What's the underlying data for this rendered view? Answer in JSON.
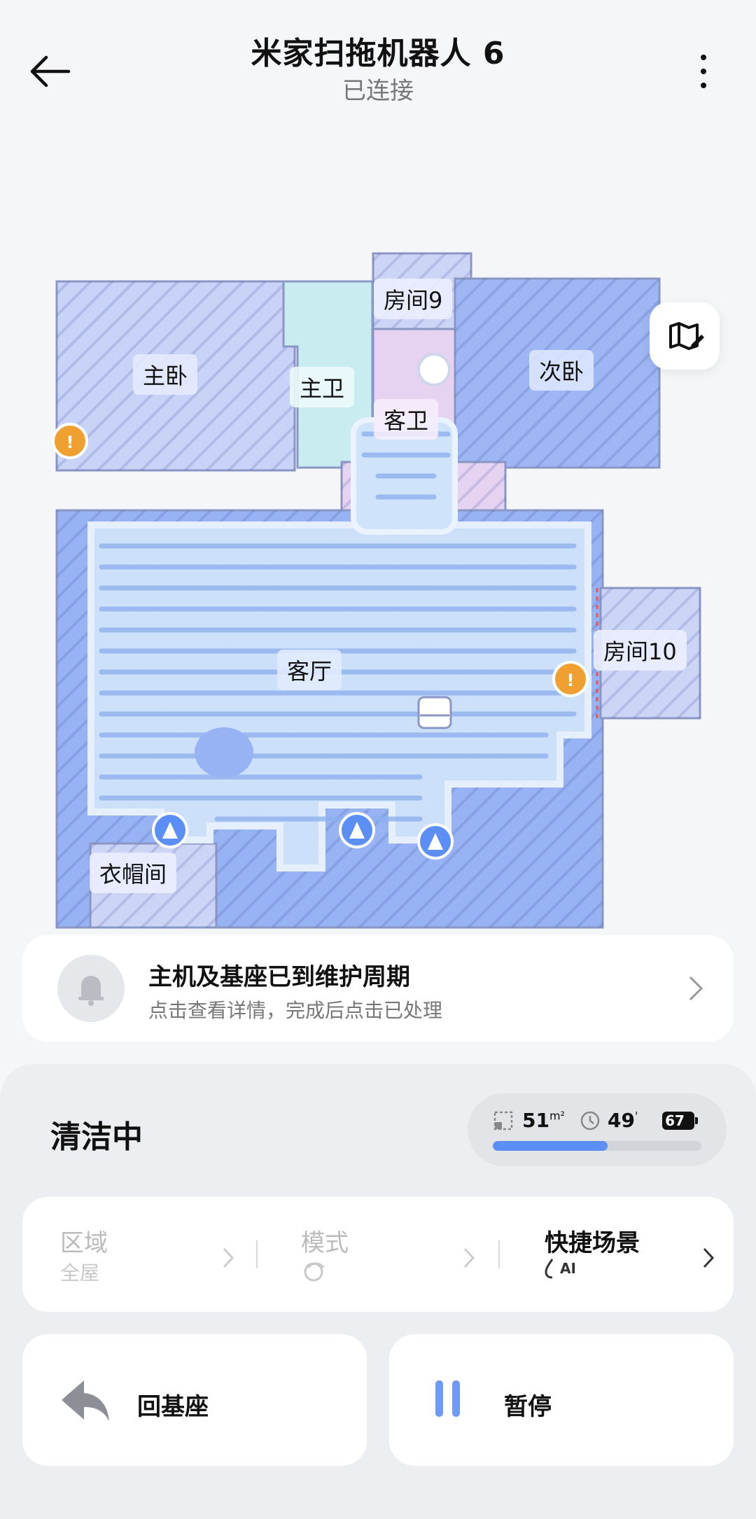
{
  "header": {
    "title": "米家扫拖机器人 6",
    "subtitle": "已连接"
  },
  "map": {
    "rooms": {
      "master_bedroom": "主卧",
      "master_bath": "主卫",
      "room9": "房间9",
      "guest_bath": "客卫",
      "second_bedroom": "次卧",
      "living_room": "客厅",
      "room10": "房间10",
      "cloakroom": "衣帽间"
    }
  },
  "notice": {
    "title": "主机及基座已到维护周期",
    "subtitle": "点击查看详情，完成后点击已处理"
  },
  "status": {
    "label": "清洁中",
    "area": "51",
    "area_unit": "m²",
    "time": "49",
    "time_unit": "'",
    "battery": "67",
    "progress": 0.55
  },
  "options": [
    {
      "label": "区域",
      "value": "全屋"
    },
    {
      "label": "模式",
      "value": ""
    },
    {
      "label": "快捷场景",
      "value": "AI"
    }
  ],
  "actions": {
    "dock_label": "回基座",
    "pause_label": "暂停"
  },
  "colors": {
    "accent": "#5b8ff5",
    "room_blue": "#9fb6f5",
    "room_cyan": "#bfe8ec",
    "room_pink": "#e3cdf0",
    "warning": "#f0a030"
  }
}
